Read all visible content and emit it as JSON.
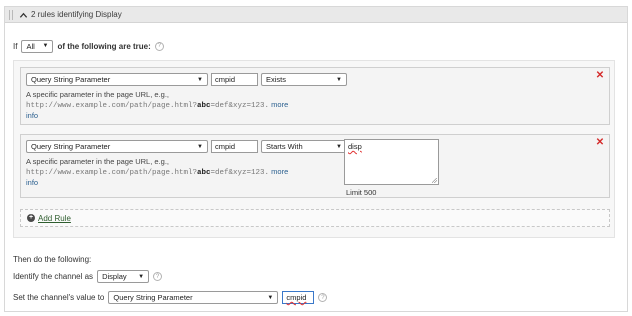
{
  "header": {
    "title": "2 rules identifying Display"
  },
  "condition": {
    "prefix": "If",
    "quantifier": "All",
    "suffix": "of the following are true:"
  },
  "rules": [
    {
      "type": "Query String Parameter",
      "param": "cmpid",
      "operator": "Exists",
      "description": "A specific parameter in the page URL, e.g.,",
      "example_before": "http://www.example.com/path/page.html?",
      "example_bold": "abc",
      "example_after": "=def&xyz=123.",
      "more_link": "more",
      "info_link": "info"
    },
    {
      "type": "Query String Parameter",
      "param": "cmpid",
      "operator": "Starts With",
      "value": "disp",
      "limit": "Limit 500",
      "description": "A specific parameter in the page URL, e.g.,",
      "example_before": "http://www.example.com/path/page.html?",
      "example_bold": "abc",
      "example_after": "=def&xyz=123.",
      "more_link": "more",
      "info_link": "info"
    }
  ],
  "add_rule": {
    "label": "Add Rule"
  },
  "actions": {
    "then_label": "Then do the following:",
    "channel_label": "Identify the channel as",
    "channel_value": "Display",
    "value_label": "Set the channel's value to",
    "value_source": "Query String Parameter",
    "value_param": "cmpid"
  },
  "colors": {
    "remove": "#d42a2a",
    "link": "#2a5f8f",
    "header_bg": "#e9e9e9"
  },
  "icons": {
    "collapse": "chevron-up-icon",
    "remove": "close-x-icon",
    "help": "question-circle-icon",
    "add": "plus-circle-icon"
  }
}
